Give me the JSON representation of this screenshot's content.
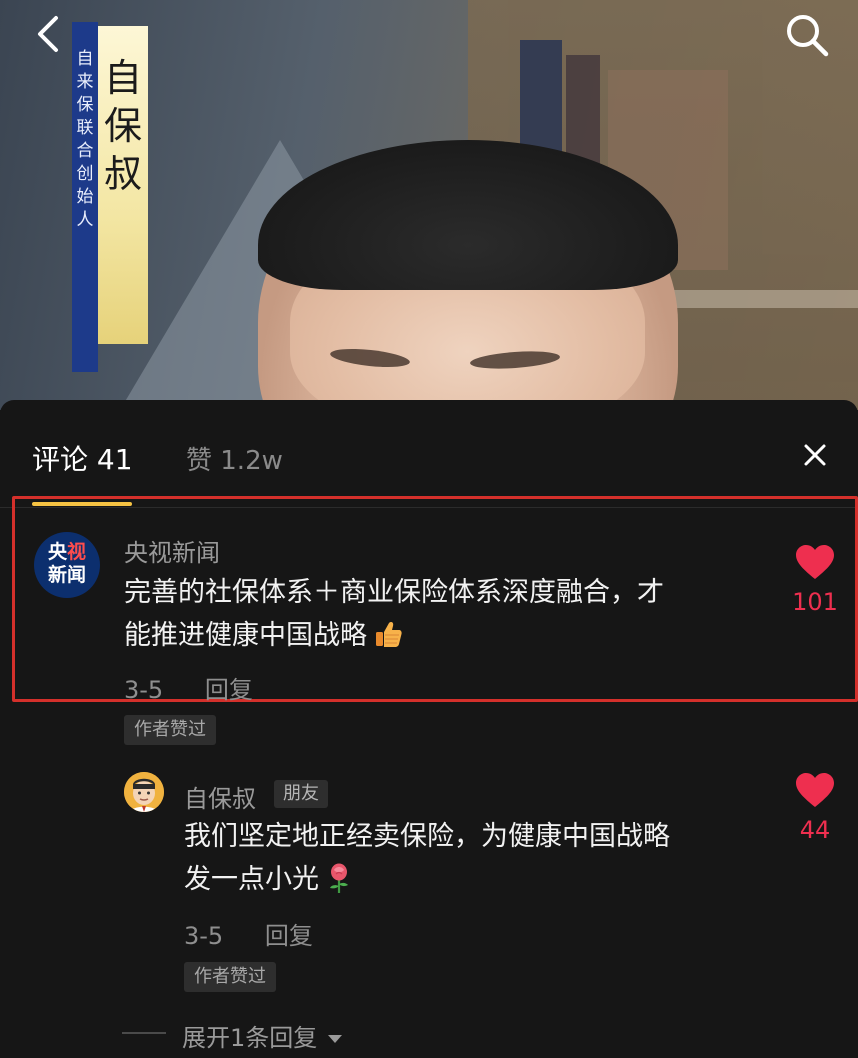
{
  "video": {
    "banner_title": "自保叔",
    "banner_subtitle": "自来保联合创始人"
  },
  "tabs": {
    "comments_label": "评论 41",
    "likes_label": "赞 1.2w"
  },
  "colors": {
    "accent_underline": "#f6c343",
    "like_red": "#ee2f4f",
    "highlight_border": "#d4302b"
  },
  "comments": [
    {
      "author": "央视新闻",
      "avatar_text": "央视新闻",
      "text_line1": "完善的社保体系＋商业保险体系深度融合，才",
      "text_line2": "能推进健康中国战略",
      "date": "3-5",
      "reply_label": "回复",
      "author_badge": "作者赞过",
      "likes": "101",
      "replies": [
        {
          "author": "自保叔",
          "tag": "朋友",
          "text_line1": "我们坚定地正经卖保险，为健康中国战略",
          "text_line2": "发一点小光",
          "date": "3-5",
          "reply_label": "回复",
          "author_badge": "作者赞过",
          "likes": "44"
        }
      ],
      "expand_label": "展开1条回复"
    }
  ],
  "icons": [
    "back-arrow-icon",
    "search-icon",
    "close-icon",
    "heart-icon",
    "thumbs-up-emoji-icon",
    "rose-emoji-icon",
    "caret-down-icon"
  ]
}
